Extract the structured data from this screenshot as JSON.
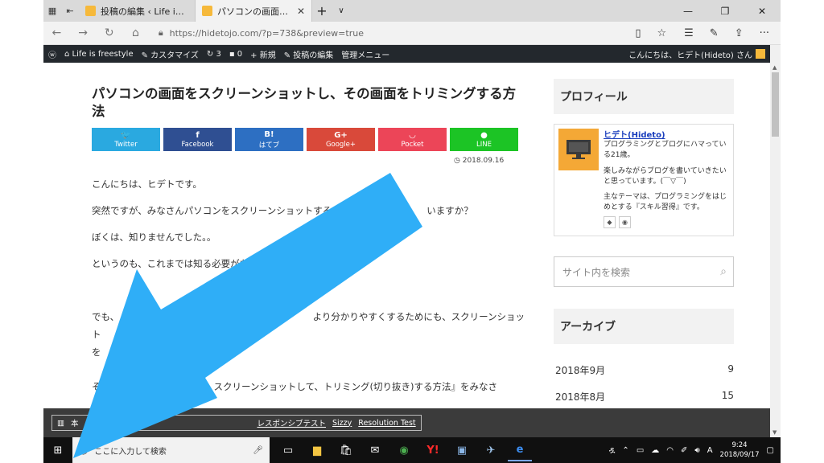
{
  "browser": {
    "tabs": [
      {
        "title": "投稿の編集 ‹ Life is freestyle",
        "active": false
      },
      {
        "title": "パソコンの画面をスクリーン",
        "active": true
      }
    ],
    "url": "https://hidetojo.com/?p=738&preview=true",
    "icons": [
      "tab-list-icon",
      "set-aside-icon",
      "close-tab-icon",
      "new-tab-icon",
      "chevron-down-icon",
      "back-icon",
      "forward-icon",
      "refresh-icon",
      "home-icon",
      "lock-icon",
      "reading-view-icon",
      "favorite-star-icon",
      "favorites-hub-icon",
      "pen-icon",
      "share-icon",
      "more-icon"
    ]
  },
  "adminbar": {
    "site": "Life is freestyle",
    "customize": "カスタマイズ",
    "updates": "3",
    "comments": "0",
    "new": "新規",
    "edit_post": "投稿の編集",
    "admin_menu": "管理メニュー",
    "greeting": "こんにちは、ヒデト(Hideto) さん"
  },
  "post": {
    "title": "パソコンの画面をスクリーンショットし、その画面をトリミングする方法",
    "share": [
      {
        "label": "Twitter",
        "icon": "twitter-icon",
        "glyph": "🐦",
        "color": "#2aa9e0"
      },
      {
        "label": "Facebook",
        "icon": "facebook-icon",
        "glyph": "f",
        "color": "#2f4f92"
      },
      {
        "label": "はてブ",
        "icon": "hatena-icon",
        "glyph": "B!",
        "color": "#2d6fc2"
      },
      {
        "label": "Google+",
        "icon": "googleplus-icon",
        "glyph": "G+",
        "color": "#d9493a"
      },
      {
        "label": "Pocket",
        "icon": "pocket-icon",
        "glyph": "◡",
        "color": "#ec4558"
      },
      {
        "label": "LINE",
        "icon": "line-icon",
        "glyph": "●",
        "color": "#1cc425"
      }
    ],
    "date": "2018.09.16",
    "p1": "こんにちは、ヒデトです。",
    "p2": "突然ですが、みなさんパソコンをスクリーンショットする",
    "p2b": "いますか？",
    "p3": "ぼくは、知りませんでした。。",
    "p4": "というのも、これまでは知る必要がなか",
    "p5a": "でも、",
    "p5b": "を始め",
    "p5c": "より分かりやすくするためにも、スクリーンショット",
    "p5d": "を",
    "p6a": "そ",
    "p6b": "スクリーンショットして、トリミング(切り抜き)する方法』をみなさ"
  },
  "sidebar": {
    "profile_heading": "プロフィール",
    "profile_name": "ヒデト(Hideto)",
    "profile_line1": "プログラミングとブログにハマってい る21歳。",
    "profile_line2": "楽しみながらブログを書いていきたい と思っています。(￣▽￣)",
    "profile_line3": "主なテーマは、プログラミングをはじ めとする『スキル習得』です。",
    "search_placeholder": "サイト内を検索",
    "archive_heading": "アーカイブ",
    "archives": [
      {
        "month": "2018年9月",
        "count": "9"
      },
      {
        "month": "2018年8月",
        "count": "15"
      }
    ]
  },
  "devbar": {
    "label": "本",
    "links": [
      "レスポンシブテスト",
      "Sizzy",
      "Resolution Test"
    ]
  },
  "taskbar": {
    "search_placeholder": "ここに入力して検索",
    "time": "9:24",
    "date": "2018/09/17",
    "ime": "A"
  },
  "overlay": {
    "arrow_color": "#2faef7"
  }
}
